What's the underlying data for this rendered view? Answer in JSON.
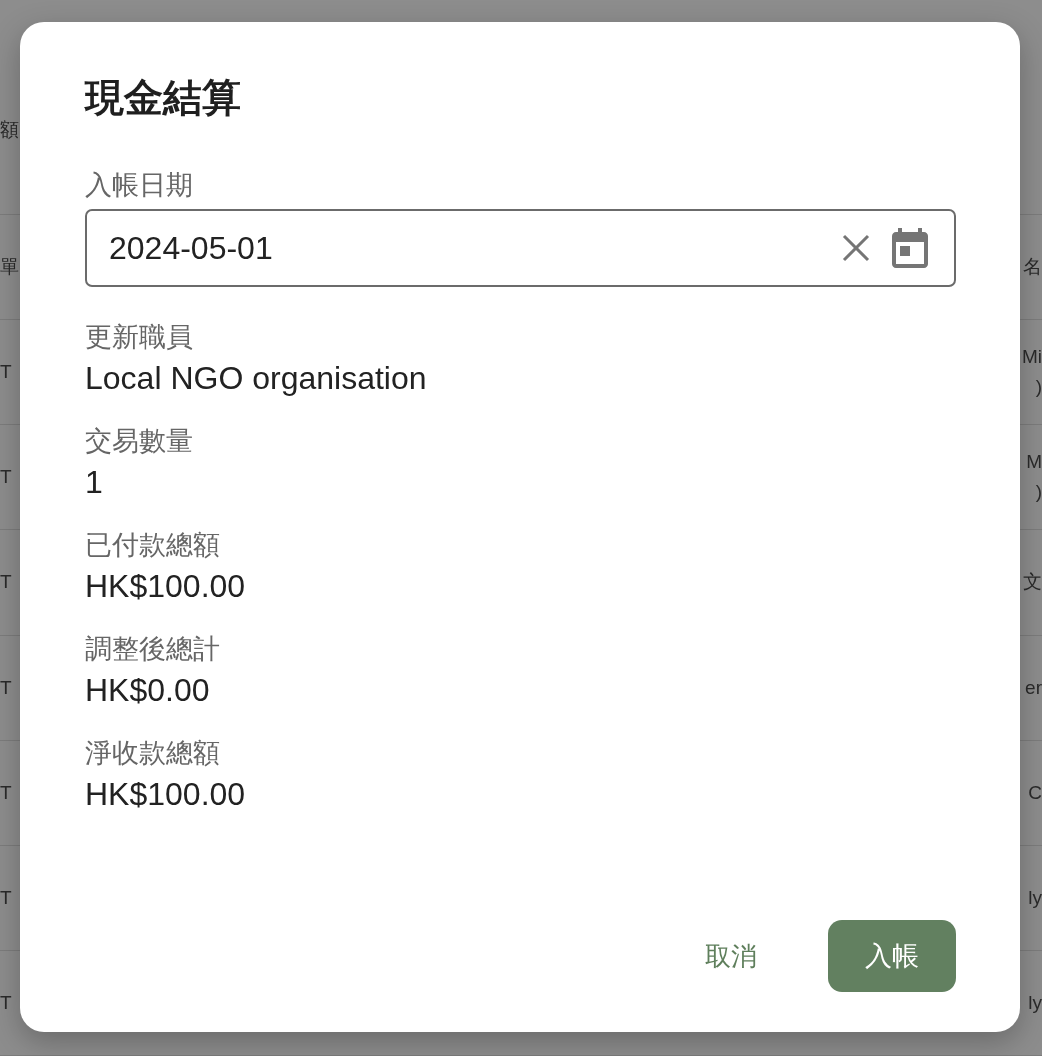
{
  "background_table": {
    "rows": [
      {
        "left": "額"
      },
      {
        "left": "單",
        "right": [
          "名"
        ]
      },
      {
        "left": "T",
        "right": [
          "Mi",
          ")"
        ]
      },
      {
        "left": "T",
        "right": [
          "M",
          ")"
        ]
      },
      {
        "left": "T",
        "right": [
          "文"
        ]
      },
      {
        "left": "T",
        "right": [
          "er"
        ]
      },
      {
        "left": "T",
        "right": [
          "C"
        ]
      },
      {
        "left": "T",
        "right": [
          "ly"
        ]
      },
      {
        "left": "T",
        "right": [
          "ly"
        ]
      }
    ]
  },
  "dialog": {
    "title": "現金結算",
    "date_field": {
      "label": "入帳日期",
      "value": "2024-05-01"
    },
    "fields": [
      {
        "label": "更新職員",
        "value": "Local NGO organisation"
      },
      {
        "label": "交易數量",
        "value": "1"
      },
      {
        "label": "已付款總額",
        "value": "HK$100.00"
      },
      {
        "label": "調整後總計",
        "value": "HK$0.00"
      },
      {
        "label": "淨收款總額",
        "value": "HK$100.00"
      }
    ],
    "buttons": [
      {
        "label": "取消",
        "kind": "text"
      },
      {
        "label": "入帳",
        "kind": "filled"
      }
    ]
  }
}
